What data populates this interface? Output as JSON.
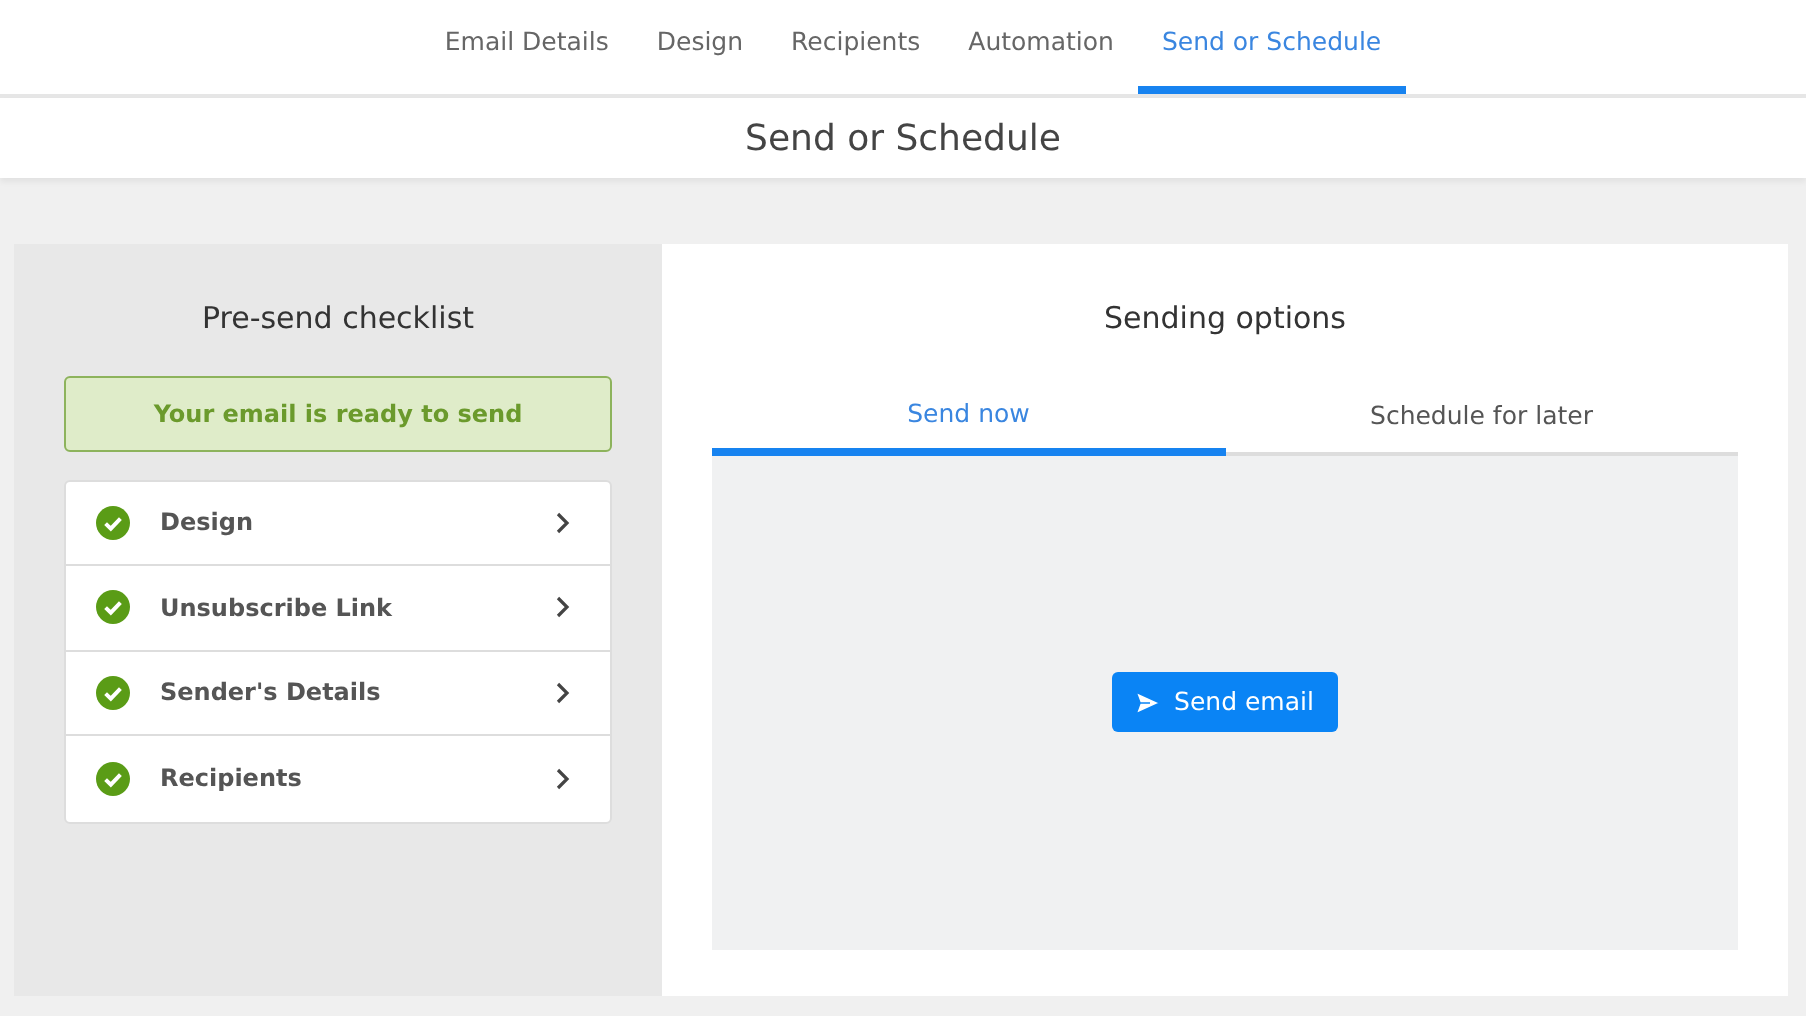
{
  "steps": [
    {
      "label": "Email Details",
      "selected": false
    },
    {
      "label": "Design",
      "selected": false
    },
    {
      "label": "Recipients",
      "selected": false
    },
    {
      "label": "Automation",
      "selected": false
    },
    {
      "label": "Send or Schedule",
      "selected": true
    }
  ],
  "page_title": "Send or Schedule",
  "checklist": {
    "title": "Pre-send checklist",
    "status": "Your email is ready to send",
    "items": [
      {
        "label": "Design",
        "checked": true
      },
      {
        "label": "Unsubscribe Link",
        "checked": true
      },
      {
        "label": "Sender's Details",
        "checked": true
      },
      {
        "label": "Recipients",
        "checked": true
      }
    ]
  },
  "sending": {
    "title": "Sending options",
    "tabs": [
      {
        "label": "Send now",
        "selected": true
      },
      {
        "label": "Schedule for later",
        "selected": false
      }
    ],
    "button": "Send email"
  }
}
